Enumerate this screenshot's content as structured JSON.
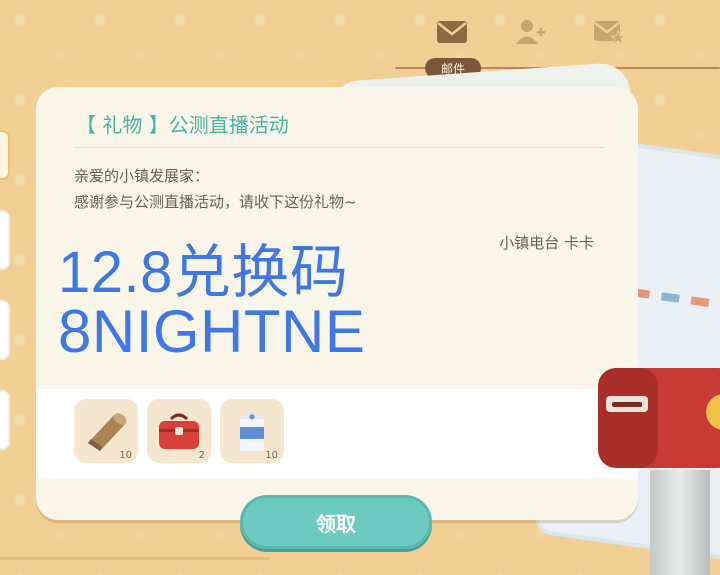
{
  "topbar": {
    "mail_icon": "envelope-icon",
    "friend_icon": "add-friend-icon",
    "favorite_mail_icon": "starred-envelope-icon",
    "mail_tab_label": "邮件"
  },
  "mail": {
    "title": "【 礼物 】公测直播活动",
    "greeting": "亲爱的小镇发展家：",
    "body": "感谢参与公测直播活动，请收下这份礼物~",
    "signature": "小镇电台 卡卡",
    "overlay_line1": "12.8兑换码",
    "overlay_line2": "8NIGHTNE",
    "rewards": [
      {
        "icon": "wood-log-icon",
        "count": "10"
      },
      {
        "icon": "red-toolbox-icon",
        "count": "2"
      },
      {
        "icon": "milk-carton-icon",
        "count": "10"
      }
    ],
    "claim_label": "领取"
  },
  "colors": {
    "accent_teal": "#6ccbc1",
    "title_teal": "#46b5a5",
    "overlay_blue": "#3f78e6",
    "background": "#f2cf95"
  }
}
